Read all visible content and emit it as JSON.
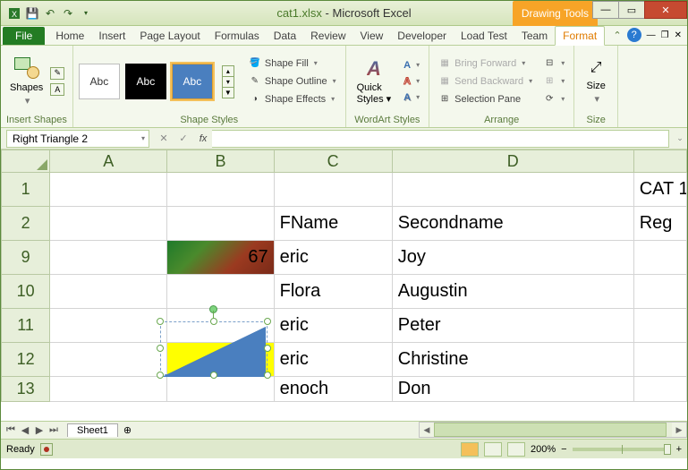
{
  "title": {
    "filename": "cat1.xlsx",
    "app": "Microsoft Excel"
  },
  "context_tab": "Drawing Tools",
  "tabs": {
    "file": "File",
    "list": [
      "Home",
      "Insert",
      "Page Layout",
      "Formulas",
      "Data",
      "Review",
      "View",
      "Developer",
      "Load Test",
      "Team"
    ],
    "active": "Format"
  },
  "ribbon": {
    "insert_shapes": {
      "label": "Insert Shapes",
      "shapes_btn": "Shapes"
    },
    "shape_styles": {
      "label": "Shape Styles",
      "sw_text": "Abc",
      "fill": "Shape Fill",
      "outline": "Shape Outline",
      "effects": "Shape Effects"
    },
    "wordart": {
      "label": "WordArt Styles",
      "quick": "Quick\nStyles"
    },
    "arrange": {
      "label": "Arrange",
      "fwd": "Bring Forward",
      "back": "Send Backward",
      "pane": "Selection Pane"
    },
    "size": {
      "label": "Size",
      "btn": "Size"
    }
  },
  "namebox": "Right Triangle 2",
  "fx_label": "fx",
  "columns": [
    "A",
    "B",
    "C",
    "D"
  ],
  "rows": [
    {
      "h": "1",
      "A": "",
      "B": "",
      "C": "",
      "D": "",
      "E": "CAT 1"
    },
    {
      "h": "2",
      "A": "",
      "B": "",
      "C": "FName",
      "D": "Secondname",
      "E": "Reg"
    },
    {
      "h": "9",
      "A": "",
      "B": "67",
      "C": "eric",
      "D": "Joy",
      "E": ""
    },
    {
      "h": "10",
      "A": "",
      "B": "",
      "C": "Flora",
      "D": "Augustin",
      "E": ""
    },
    {
      "h": "11",
      "A": "",
      "B": "",
      "C": "eric",
      "D": "Peter",
      "E": ""
    },
    {
      "h": "12",
      "A": "",
      "B": "",
      "C": "eric",
      "D": "Christine",
      "E": ""
    },
    {
      "h": "13",
      "A": "",
      "B": "",
      "C": "enoch",
      "D": "Don",
      "E": ""
    }
  ],
  "sheet": {
    "name": "Sheet1"
  },
  "status": {
    "ready": "Ready",
    "zoom": "200%"
  }
}
